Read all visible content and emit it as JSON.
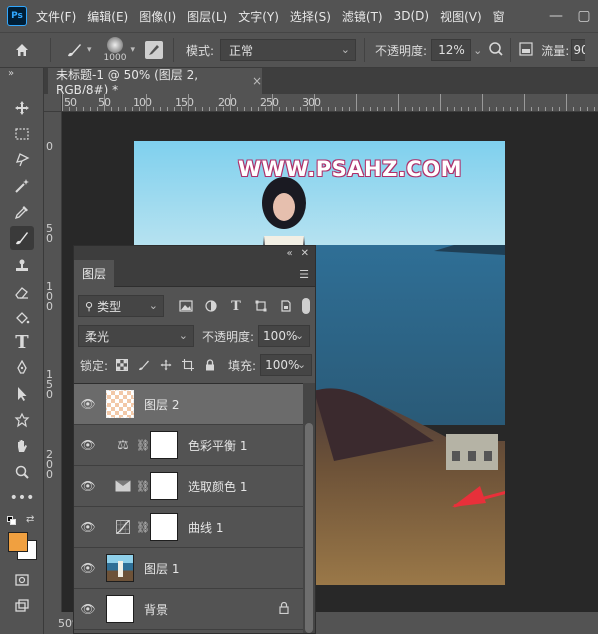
{
  "app": {
    "logo": "Ps",
    "menu": [
      "文件(F)",
      "编辑(E)",
      "图像(I)",
      "图层(L)",
      "文字(Y)",
      "选择(S)",
      "滤镜(T)",
      "3D(D)",
      "视图(V)",
      "窗"
    ],
    "window_buttons": [
      "—",
      "▢"
    ]
  },
  "options_bar": {
    "brush_size": "1000",
    "mode_label": "模式:",
    "mode_value": "正常",
    "opacity_label": "不透明度:",
    "opacity_value": "12%",
    "flow_label": "流量:",
    "flow_value": "90"
  },
  "document_tab": {
    "title": "未标题-1 @ 50% (图层 2, RGB/8#) *",
    "close": "×"
  },
  "ruler": {
    "h_labels": [
      "5",
      "0",
      "5",
      "0",
      "1",
      "0",
      "0",
      "1",
      "5",
      "0",
      "2",
      "0",
      "0",
      "2",
      "5",
      "0",
      "3",
      "0",
      "0"
    ],
    "v_labels": [
      "0",
      "5 0",
      "1 0 0",
      "1 5 0",
      "2 0 0"
    ]
  },
  "canvas": {
    "watermark": "WWW.PSAHZ.COM",
    "accent_arrow_color": "#e8303a"
  },
  "status": {
    "zoom": "50%"
  },
  "layers_panel": {
    "tab_label": "图层",
    "filter_kind": "类型",
    "blend_mode": "柔光",
    "opacity_label": "不透明度:",
    "opacity_value": "100%",
    "lock_label": "锁定:",
    "fill_label": "填充:",
    "fill_value": "100%",
    "layers": [
      {
        "name": "图层 2",
        "kind": "pixel-transparent",
        "selected": true
      },
      {
        "name": "色彩平衡 1",
        "kind": "adjustment",
        "icon": "balance-icon"
      },
      {
        "name": "选取颜色 1",
        "kind": "adjustment",
        "icon": "selective-color-icon"
      },
      {
        "name": "曲线 1",
        "kind": "adjustment",
        "icon": "curves-icon"
      },
      {
        "name": "图层 1",
        "kind": "photo"
      },
      {
        "name": "背景",
        "kind": "background",
        "locked": true
      }
    ]
  },
  "colors": {
    "foreground": "#f0a040",
    "background": "#ffffff"
  }
}
